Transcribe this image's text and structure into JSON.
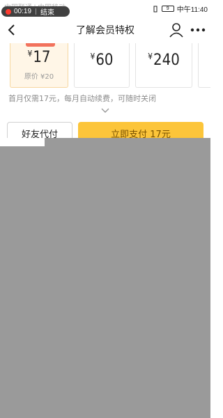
{
  "status_bar": {
    "carrier_text": "中国联通 | 中国移动",
    "rec_time": "00:19",
    "rec_end_label": "结束",
    "battery": "9",
    "clock": "中午11:40"
  },
  "nav": {
    "title": "了解会员特权"
  },
  "plans": [
    {
      "currency": "¥",
      "price": "17",
      "original": "原价 ¥20",
      "selected": true
    },
    {
      "currency": "¥",
      "price": "60",
      "original": "",
      "selected": false
    },
    {
      "currency": "¥",
      "price": "240",
      "original": "",
      "selected": false
    }
  ],
  "renew_note": "首月仅需17元，每月自动续费，可随时关闭",
  "buttons": {
    "friend_pay": "好友代付",
    "pay_now": "立即支付 17元"
  },
  "colors": {
    "accent": "#fcc53a",
    "badge": "#f2725c",
    "selected_bg": "#fff6e7",
    "overlay": "#9a9a9a"
  }
}
